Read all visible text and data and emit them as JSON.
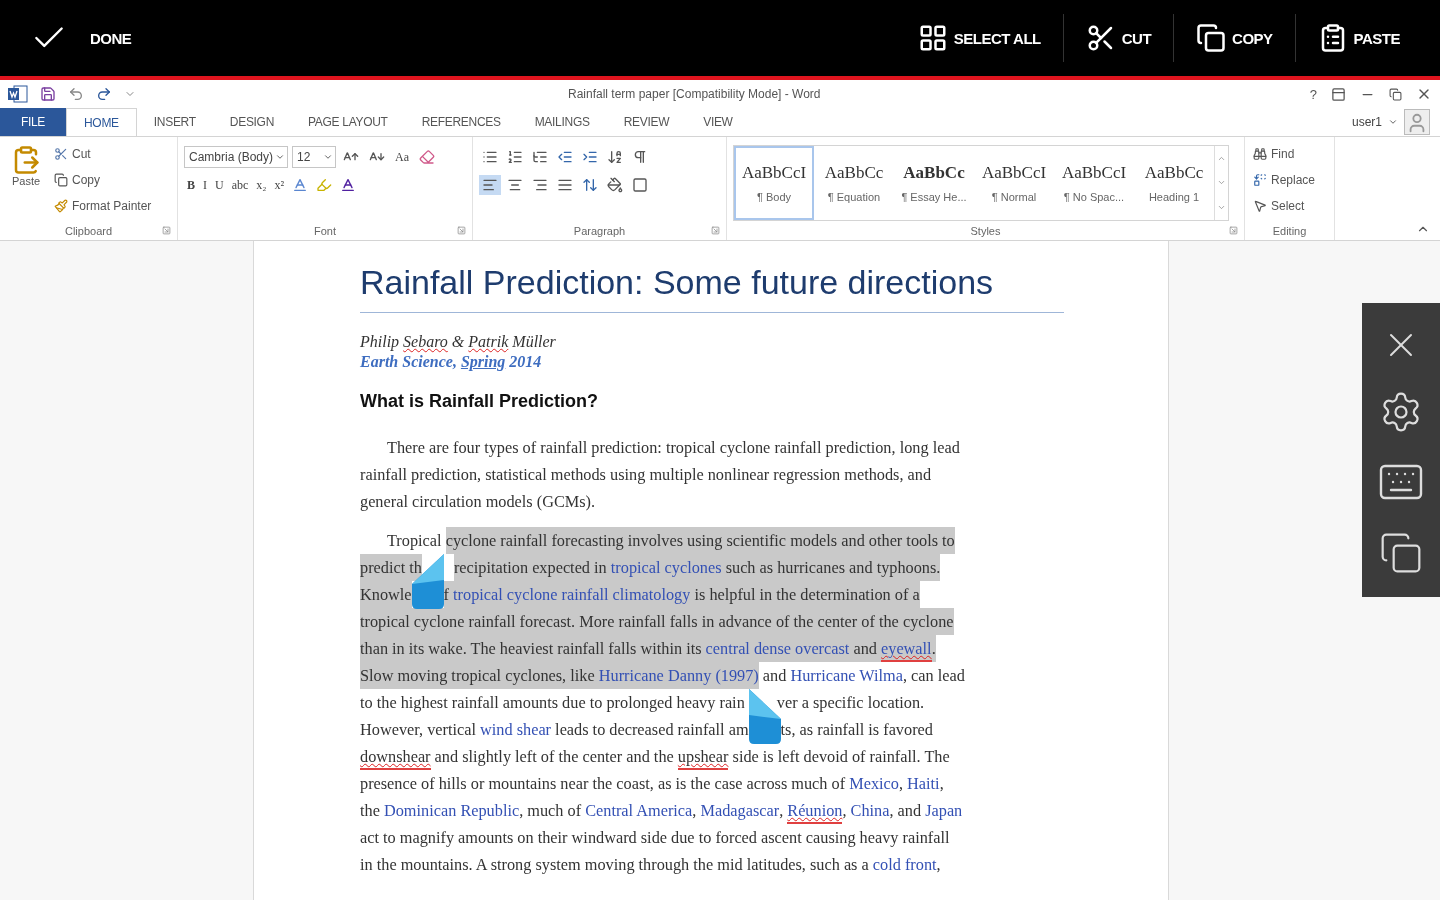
{
  "action_bar": {
    "done": "DONE",
    "actions": [
      {
        "label": "SELECT ALL",
        "kind": "select"
      },
      {
        "label": "CUT",
        "kind": "cut"
      },
      {
        "label": "COPY",
        "kind": "copy"
      },
      {
        "label": "PASTE",
        "kind": "paste"
      }
    ]
  },
  "title_bar": {
    "title": "Rainfall term paper [Compatibility Mode] - Word",
    "help": "?"
  },
  "tabs": [
    {
      "label": "FILE",
      "kind": "file",
      "selected": false
    },
    {
      "label": "HOME",
      "kind": "tab",
      "selected": true
    },
    {
      "label": "INSERT",
      "kind": "tab",
      "selected": false
    },
    {
      "label": "DESIGN",
      "kind": "tab",
      "selected": false
    },
    {
      "label": "PAGE LAYOUT",
      "kind": "tab",
      "selected": false
    },
    {
      "label": "REFERENCES",
      "kind": "tab",
      "selected": false
    },
    {
      "label": "MAILINGS",
      "kind": "tab",
      "selected": false
    },
    {
      "label": "REVIEW",
      "kind": "tab",
      "selected": false
    },
    {
      "label": "VIEW",
      "kind": "tab",
      "selected": false
    }
  ],
  "user": "user1",
  "ribbon": {
    "clipboard": {
      "label": "Clipboard",
      "paste": "Paste",
      "items": [
        {
          "label": "Cut",
          "kind": "cut"
        },
        {
          "label": "Copy",
          "kind": "copy"
        },
        {
          "label": "Format Painter",
          "kind": "painter"
        }
      ]
    },
    "font": {
      "label": "Font",
      "font": "Cambria (Body)",
      "size": "12",
      "case": "Aa",
      "formats": [
        "B",
        "I",
        "U",
        "abc",
        "x₂",
        "x²"
      ]
    },
    "paragraph": {
      "label": "Paragraph",
      "alignments": [
        {
          "kind": "left",
          "selected": true
        },
        {
          "kind": "center",
          "selected": false
        },
        {
          "kind": "right",
          "selected": false
        },
        {
          "kind": "justify",
          "selected": false
        }
      ]
    },
    "styles": {
      "label": "Styles",
      "items": [
        {
          "sample": "AaBbCcI",
          "name": "¶ Body",
          "bold": false,
          "selected": true
        },
        {
          "sample": "AaBbCc",
          "name": "¶ Equation",
          "bold": false,
          "selected": false
        },
        {
          "sample": "AaBbCc",
          "name": "¶ Essay He...",
          "bold": true,
          "selected": false
        },
        {
          "sample": "AaBbCcI",
          "name": "¶ Normal",
          "bold": false,
          "selected": false
        },
        {
          "sample": "AaBbCcI",
          "name": "¶ No Spac...",
          "bold": false,
          "selected": false
        },
        {
          "sample": "AaBbCc",
          "name": "Heading 1",
          "bold": false,
          "selected": false
        }
      ]
    },
    "editing": {
      "label": "Editing",
      "items": [
        {
          "label": "Find",
          "kind": "find"
        },
        {
          "label": "Replace",
          "kind": "replace"
        },
        {
          "label": "Select",
          "kind": "select"
        }
      ]
    }
  },
  "document": {
    "title": "Rainfall Prediction: Some future directions",
    "authors": [
      {
        "text": "Philip ",
        "misspelled": false
      },
      {
        "text": "Sebaro",
        "misspelled": true
      },
      {
        "text": " & ",
        "misspelled": false
      },
      {
        "text": "Patrik",
        "misspelled": true
      },
      {
        "text": " Müller",
        "misspelled": false
      }
    ],
    "affiliation": [
      {
        "text": "Earth Science, ",
        "kind": "plain"
      },
      {
        "text": "Spring",
        "kind": "link"
      },
      {
        "text": " 2014",
        "kind": "plain"
      }
    ],
    "heading": "What is Rainfall Prediction?",
    "paragraphs": [
      [
        [
          {
            "text": "There are four types of rainfall prediction: tropical cyclone rainfall prediction, long lead",
            "kind": "plain",
            "misspelled": false,
            "selected": false
          }
        ],
        [
          {
            "text": "rainfall prediction, statistical methods using multiple nonlinear regression methods, and",
            "kind": "plain",
            "misspelled": false,
            "selected": false
          }
        ],
        [
          {
            "text": "general circulation models (GCMs).",
            "kind": "plain",
            "misspelled": false,
            "selected": false
          }
        ]
      ],
      [
        [
          {
            "text": "Tropical ",
            "kind": "plain",
            "misspelled": false,
            "selected": false
          },
          {
            "text": "cyclone rainfall forecasting involves using scientific models and other tools to",
            "kind": "plain",
            "misspelled": false,
            "selected": true
          }
        ],
        [
          {
            "text": "predict th",
            "kind": "plain",
            "misspelled": false,
            "selected": true
          },
          {
            "kind": "gap"
          },
          {
            "text": "recipitation expected in ",
            "kind": "plain",
            "misspelled": false,
            "selected": true
          },
          {
            "text": "tropical cyclones",
            "kind": "link",
            "misspelled": false,
            "selected": true
          },
          {
            "text": " such as hurricanes and typhoons.",
            "kind": "plain",
            "misspelled": false,
            "selected": true
          }
        ],
        [
          {
            "text": "Knowle",
            "kind": "plain",
            "misspelled": false,
            "selected": true
          },
          {
            "kind": "handle",
            "selected": true
          },
          {
            "text": "f ",
            "kind": "plain",
            "misspelled": false,
            "selected": true
          },
          {
            "text": "tropical cyclone rainfall climatology",
            "kind": "link",
            "misspelled": false,
            "selected": true
          },
          {
            "text": " is helpful in the determination of a",
            "kind": "plain",
            "misspelled": false,
            "selected": true
          }
        ],
        [
          {
            "text": "tropical cyclone rainfall forecast. More rainfall falls in advance of the center of the cyclone",
            "kind": "plain",
            "misspelled": false,
            "selected": true
          }
        ],
        [
          {
            "text": "than in its wake. The heaviest rainfall falls within its ",
            "kind": "plain",
            "misspelled": false,
            "selected": true
          },
          {
            "text": "central dense overcast",
            "kind": "link",
            "misspelled": false,
            "selected": true
          },
          {
            "text": " and ",
            "kind": "plain",
            "misspelled": false,
            "selected": true
          },
          {
            "text": "eyewall",
            "kind": "link",
            "misspelled": true,
            "selected": true
          },
          {
            "text": ".",
            "kind": "plain",
            "misspelled": false,
            "selected": true
          }
        ],
        [
          {
            "text": "Slow moving tropical cyclones, like ",
            "kind": "plain",
            "misspelled": false,
            "selected": true
          },
          {
            "text": "Hurricane Danny (1997)",
            "kind": "link",
            "misspelled": false,
            "selected": true
          },
          {
            "text": " and ",
            "kind": "plain",
            "misspelled": false,
            "selected": false
          },
          {
            "text": "Hurricane Wilma",
            "kind": "link",
            "misspelled": false,
            "selected": false
          },
          {
            "text": ", can lead",
            "kind": "plain",
            "misspelled": false,
            "selected": false
          }
        ],
        [
          {
            "text": "to the highest rainfall amounts due to prolonged heavy rain",
            "kind": "plain",
            "misspelled": false,
            "selected": false
          },
          {
            "kind": "gap"
          },
          {
            "text": "ver a specific location.",
            "kind": "plain",
            "misspelled": false,
            "selected": false
          }
        ],
        [
          {
            "text": "However, vertical ",
            "kind": "plain",
            "misspelled": false,
            "selected": false
          },
          {
            "text": "wind shear",
            "kind": "link",
            "misspelled": false,
            "selected": false
          },
          {
            "text": " leads to decreased rainfall am",
            "kind": "plain",
            "misspelled": false,
            "selected": false
          },
          {
            "kind": "handle",
            "selected": false
          },
          {
            "text": "ts, as rainfall is favored",
            "kind": "plain",
            "misspelled": false,
            "selected": false
          }
        ],
        [
          {
            "text": "downshear",
            "kind": "plain",
            "misspelled": true,
            "selected": false
          },
          {
            "text": " and slightly left of the center and the ",
            "kind": "plain",
            "misspelled": false,
            "selected": false
          },
          {
            "text": "upshear",
            "kind": "plain",
            "misspelled": true,
            "selected": false
          },
          {
            "text": " side is left devoid of rainfall. The",
            "kind": "plain",
            "misspelled": false,
            "selected": false
          }
        ],
        [
          {
            "text": "presence of hills or mountains near the coast, as is the case across much of ",
            "kind": "plain",
            "misspelled": false,
            "selected": false
          },
          {
            "text": "Mexico",
            "kind": "link",
            "misspelled": false,
            "selected": false
          },
          {
            "text": ", ",
            "kind": "plain",
            "misspelled": false,
            "selected": false
          },
          {
            "text": "Haiti",
            "kind": "link",
            "misspelled": false,
            "selected": false
          },
          {
            "text": ",",
            "kind": "plain",
            "misspelled": false,
            "selected": false
          }
        ],
        [
          {
            "text": "the ",
            "kind": "plain",
            "misspelled": false,
            "selected": false
          },
          {
            "text": "Dominican Republic",
            "kind": "link",
            "misspelled": false,
            "selected": false
          },
          {
            "text": ", much of ",
            "kind": "plain",
            "misspelled": false,
            "selected": false
          },
          {
            "text": "Central America",
            "kind": "link",
            "misspelled": false,
            "selected": false
          },
          {
            "text": ", ",
            "kind": "plain",
            "misspelled": false,
            "selected": false
          },
          {
            "text": "Madagascar",
            "kind": "link",
            "misspelled": false,
            "selected": false
          },
          {
            "text": ", ",
            "kind": "plain",
            "misspelled": false,
            "selected": false
          },
          {
            "text": "Réunion",
            "kind": "link",
            "misspelled": true,
            "selected": false
          },
          {
            "text": ", ",
            "kind": "plain",
            "misspelled": false,
            "selected": false
          },
          {
            "text": "China",
            "kind": "link",
            "misspelled": false,
            "selected": false
          },
          {
            "text": ", and ",
            "kind": "plain",
            "misspelled": false,
            "selected": false
          },
          {
            "text": "Japan",
            "kind": "link",
            "misspelled": false,
            "selected": false
          }
        ],
        [
          {
            "text": "act to magnify amounts on their windward side due to forced ascent causing heavy rainfall",
            "kind": "plain",
            "misspelled": false,
            "selected": false
          }
        ],
        [
          {
            "text": "in the mountains. A strong system moving through the mid latitudes, such as a ",
            "kind": "plain",
            "misspelled": false,
            "selected": false
          },
          {
            "text": "cold front",
            "kind": "link",
            "misspelled": false,
            "selected": false
          },
          {
            "text": ",",
            "kind": "plain",
            "misspelled": false,
            "selected": false
          }
        ]
      ]
    ]
  }
}
